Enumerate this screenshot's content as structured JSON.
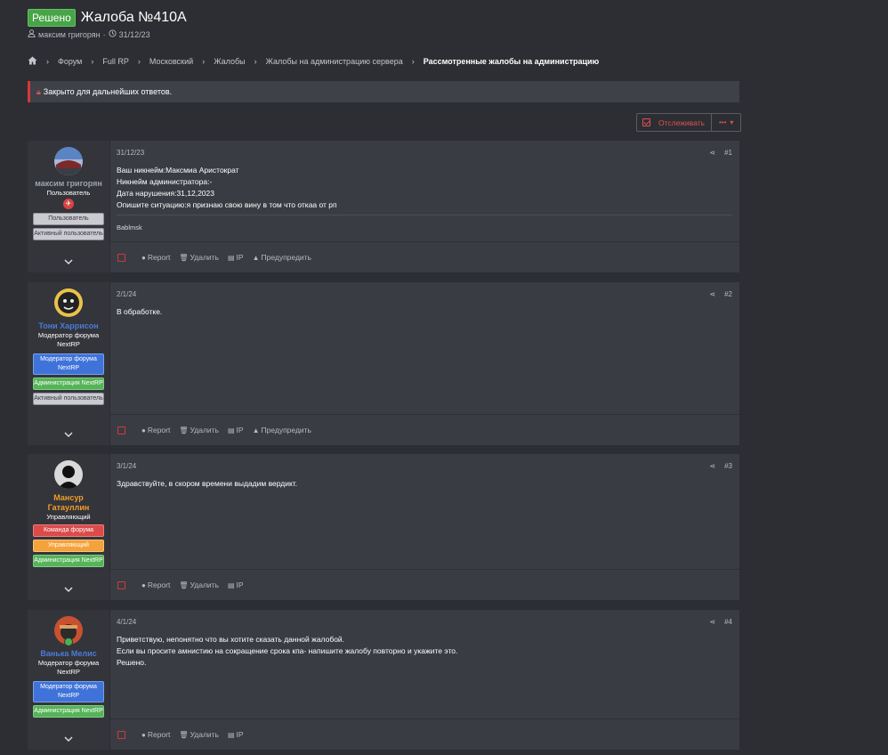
{
  "thread": {
    "status_badge": "Решено",
    "title": "Жалоба №410A",
    "author": "максим григорян",
    "date": "31/12/23"
  },
  "breadcrumbs": [
    "Форум",
    "Full RP",
    "Московский",
    "Жалобы",
    "Жалобы на администрацию сервера",
    "Рассмотренные жалобы на администрацию"
  ],
  "notice": "Закрыто для дальнейших ответов.",
  "watch": {
    "label": "Отслеживать",
    "more": "•••"
  },
  "actions": {
    "report": "Report",
    "delete": "Удалить",
    "ip": "IP",
    "warn": "Предупредить"
  },
  "posts": [
    {
      "user": "максим григорян",
      "user_color": "#9ea3ab",
      "user_title": "Пользователь",
      "banners": [
        {
          "label": "Пользователь",
          "kind": "b-user"
        },
        {
          "label": "Активный пользователь",
          "kind": "b-user"
        }
      ],
      "date": "31/12/23",
      "num": "#1",
      "text": "Ваш никнейм:Максмиа Аристократ\nНикнейм администратора:-\nДата нарушения:31,12,2023\nОпишите ситуацию:я признаю свою вину в том что откаа от рп",
      "signature": "Bablmsk"
    },
    {
      "user": "Тони Харрисон",
      "user_color": "#4b7bd8",
      "user_title": "Модератор форума NextRP",
      "banners": [
        {
          "label": "Модератор форума NextRP",
          "kind": "b-mod"
        },
        {
          "label": "Администрация NextRP",
          "kind": "b-adm"
        },
        {
          "label": "Активный пользователь",
          "kind": "b-user"
        }
      ],
      "date": "2/1/24",
      "num": "#2",
      "text": "В обработке."
    },
    {
      "user": "Мансур Гатауллин",
      "user_color": "#f39c27",
      "user_title": "Управляющий",
      "banners": [
        {
          "label": "Команда форума",
          "kind": "b-team"
        },
        {
          "label": "Управляющий",
          "kind": "b-mgr"
        },
        {
          "label": "Администрация NextRP",
          "kind": "b-adm"
        }
      ],
      "date": "3/1/24",
      "num": "#3",
      "text": "Здравствуйте, в скором времени выдадим вердикт."
    },
    {
      "user": "Ванька Мелис",
      "user_color": "#4b7bd8",
      "user_title": "Модератор форума NextRP",
      "banners": [
        {
          "label": "Модератор форума NextRP",
          "kind": "b-mod"
        },
        {
          "label": "Администрация NextRP",
          "kind": "b-adm"
        }
      ],
      "date": "4/1/24",
      "num": "#4",
      "text": "Приветствую, непонятно что вы хотите сказать данной жалобой.\nЕсли вы просите амнистию на сокращение срока кпа- напишите жалобу повторно и укажите это.\nРешено."
    }
  ]
}
